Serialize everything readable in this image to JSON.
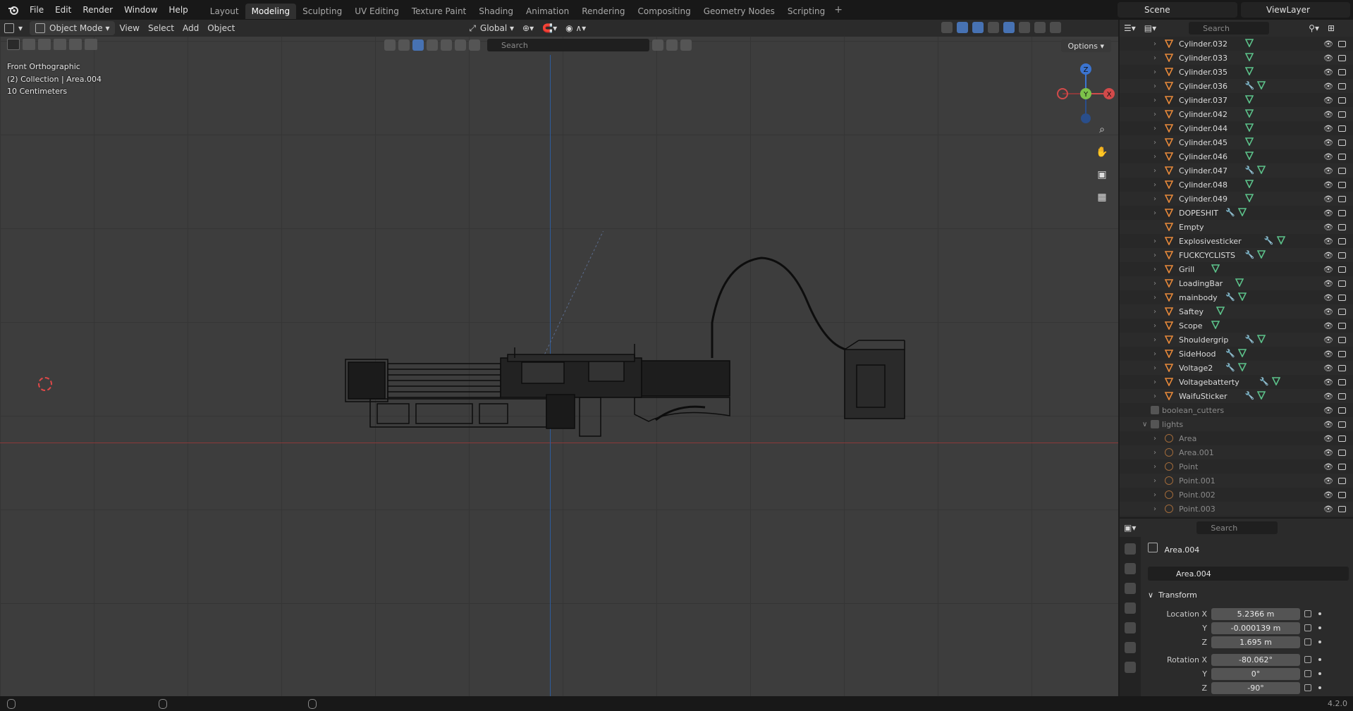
{
  "menu": [
    "File",
    "Edit",
    "Render",
    "Window",
    "Help"
  ],
  "workspaces": [
    {
      "label": "Layout",
      "active": false
    },
    {
      "label": "Modeling",
      "active": true
    },
    {
      "label": "Sculpting",
      "active": false
    },
    {
      "label": "UV Editing",
      "active": false
    },
    {
      "label": "Texture Paint",
      "active": false
    },
    {
      "label": "Shading",
      "active": false
    },
    {
      "label": "Animation",
      "active": false
    },
    {
      "label": "Rendering",
      "active": false
    },
    {
      "label": "Compositing",
      "active": false
    },
    {
      "label": "Geometry Nodes",
      "active": false
    },
    {
      "label": "Scripting",
      "active": false
    }
  ],
  "scene": {
    "label": "Scene"
  },
  "view_layer": {
    "label": "ViewLayer"
  },
  "viewport": {
    "mode": "Object Mode",
    "menu": [
      "View",
      "Select",
      "Add",
      "Object"
    ],
    "transform_orientation": "Global",
    "search_placeholder": "Search",
    "options_label": "Options",
    "overlay": {
      "view_name": "Front Orthographic",
      "collection_info": "(2) Collection | Area.004",
      "scale": "10 Centimeters"
    },
    "gizmo": {
      "z": "Z",
      "y": "Y",
      "x": "X"
    }
  },
  "outliner": {
    "search_placeholder": "Search",
    "objects": [
      {
        "name": "Cylinder.032",
        "mods": false
      },
      {
        "name": "Cylinder.033",
        "mods": false
      },
      {
        "name": "Cylinder.035",
        "mods": false
      },
      {
        "name": "Cylinder.036",
        "mods": true
      },
      {
        "name": "Cylinder.037",
        "mods": false
      },
      {
        "name": "Cylinder.042",
        "mods": false
      },
      {
        "name": "Cylinder.044",
        "mods": false
      },
      {
        "name": "Cylinder.045",
        "mods": false
      },
      {
        "name": "Cylinder.046",
        "mods": false
      },
      {
        "name": "Cylinder.047",
        "mods": true
      },
      {
        "name": "Cylinder.048",
        "mods": false
      },
      {
        "name": "Cylinder.049",
        "mods": false
      },
      {
        "name": "DOPESHIT",
        "mods": true
      },
      {
        "name": "Empty",
        "mods": false,
        "empty": true
      },
      {
        "name": "Explosivesticker",
        "mods": true
      },
      {
        "name": "FUCKCYCLISTS",
        "mods": true
      },
      {
        "name": "Grill",
        "mods": false
      },
      {
        "name": "LoadingBar",
        "mods": false
      },
      {
        "name": "mainbody",
        "mods": true
      },
      {
        "name": "Saftey",
        "mods": false
      },
      {
        "name": "Scope",
        "mods": false
      },
      {
        "name": "Shouldergrip",
        "mods": true
      },
      {
        "name": "SideHood",
        "mods": true
      },
      {
        "name": "Voltage2",
        "mods": true
      },
      {
        "name": "Voltagebatterty",
        "mods": true
      },
      {
        "name": "WaifuSticker",
        "mods": true
      }
    ],
    "collections": [
      {
        "name": "boolean_cutters"
      },
      {
        "name": "lights"
      }
    ],
    "lights": [
      "Area",
      "Area.001",
      "Point",
      "Point.001",
      "Point.002",
      "Point.003"
    ]
  },
  "properties": {
    "search_placeholder": "Search",
    "object_name": "Area.004",
    "name_field": "Area.004",
    "transform_label": "Transform",
    "location": {
      "label": "Location X",
      "x": "5.2366 m",
      "y": "-0.000139 m",
      "z": "1.695 m"
    },
    "rotation": {
      "label": "Rotation X",
      "x": "-80.062°",
      "y": "0°",
      "z": "-90°"
    },
    "axis_y": "Y",
    "axis_z": "Z"
  },
  "status": {
    "version": "4.2.0"
  },
  "colors": {
    "accent": "#4772b3",
    "object_icon": "#e8893a",
    "mesh_data": "#5cc28a",
    "modifier": "#6f8fd8",
    "axis_x": "#8b3a3a",
    "axis_z": "#2e5c9c"
  }
}
